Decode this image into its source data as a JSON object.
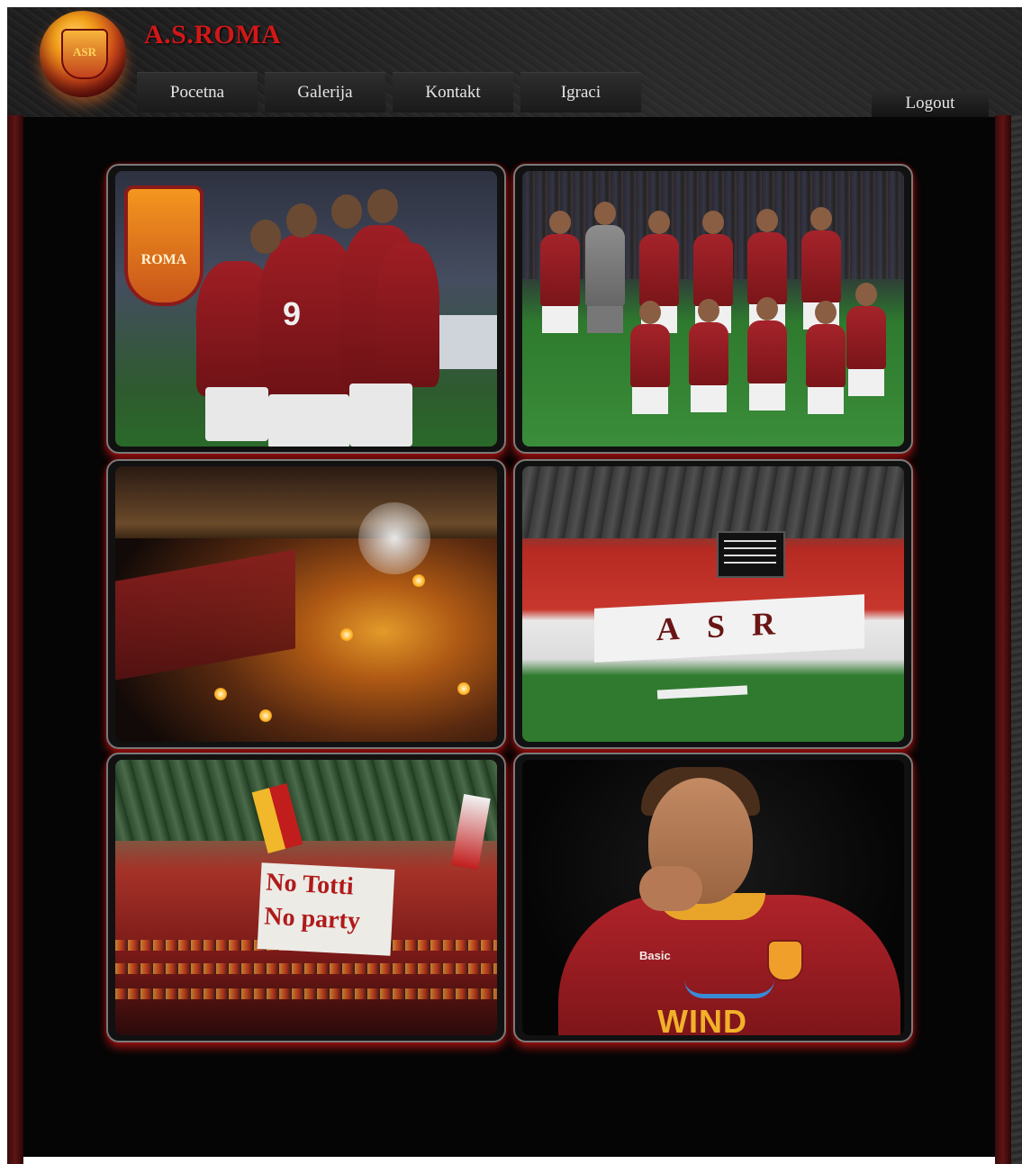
{
  "header": {
    "site_title": "A.S.ROMA",
    "logo_text": "ASR",
    "nav": [
      "Pocetna",
      "Galerija",
      "Kontakt",
      "Igraci"
    ],
    "logout_label": "Logout"
  },
  "gallery": {
    "tiles": [
      {
        "label": "ROMA",
        "number": "9"
      },
      {
        "label": ""
      },
      {
        "label": ""
      },
      {
        "label": "ASR"
      },
      {
        "sign_line_1": "No Totti",
        "sign_line_2": "No party"
      },
      {
        "sponsor": "WIND",
        "brand": "Basic"
      }
    ]
  },
  "colors": {
    "title_red": "#d01818",
    "border_red": "#7a0e0e",
    "background": "#050505"
  }
}
